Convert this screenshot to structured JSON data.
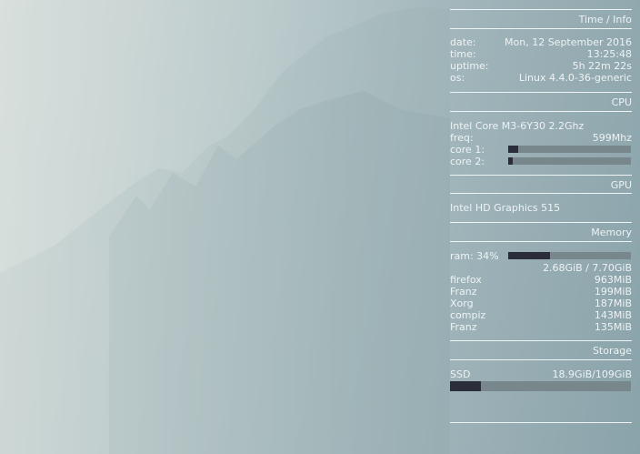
{
  "colors": {
    "text": "#eef3f4",
    "bar_track": "#77878c",
    "bar_fill": "#2b2e3a"
  },
  "time_info": {
    "title": "Time / Info",
    "rows": [
      {
        "label": "date:",
        "value": "Mon, 12 September 2016"
      },
      {
        "label": "time:",
        "value": "13:25:48"
      },
      {
        "label": "uptime:",
        "value": "5h 22m 22s"
      },
      {
        "label": "os:",
        "value": "Linux 4.4.0-36-generic"
      }
    ]
  },
  "cpu": {
    "title": "CPU",
    "model": "Intel Core M3-6Y30 2.2Ghz",
    "freq_label": "freq:",
    "freq_value": "599Mhz",
    "cores": [
      {
        "label": "core 1:",
        "usage_fraction": 0.08
      },
      {
        "label": "core 2:",
        "usage_fraction": 0.04
      }
    ]
  },
  "gpu": {
    "title": "GPU",
    "model": "Intel HD Graphics 515"
  },
  "memory": {
    "title": "Memory",
    "ram_label": "ram: 34%",
    "ram_fraction": 0.34,
    "ram_used_total": "2.68GiB / 7.70GiB",
    "processes": [
      {
        "name": "firefox",
        "mem": "963MiB"
      },
      {
        "name": "Franz",
        "mem": "199MiB"
      },
      {
        "name": "Xorg",
        "mem": "187MiB"
      },
      {
        "name": "compiz",
        "mem": "143MiB"
      },
      {
        "name": "Franz",
        "mem": "135MiB"
      }
    ]
  },
  "storage": {
    "title": "Storage",
    "ssd_label": "SSD",
    "ssd_value": "18.9GiB/109GiB",
    "ssd_fraction": 0.17
  }
}
